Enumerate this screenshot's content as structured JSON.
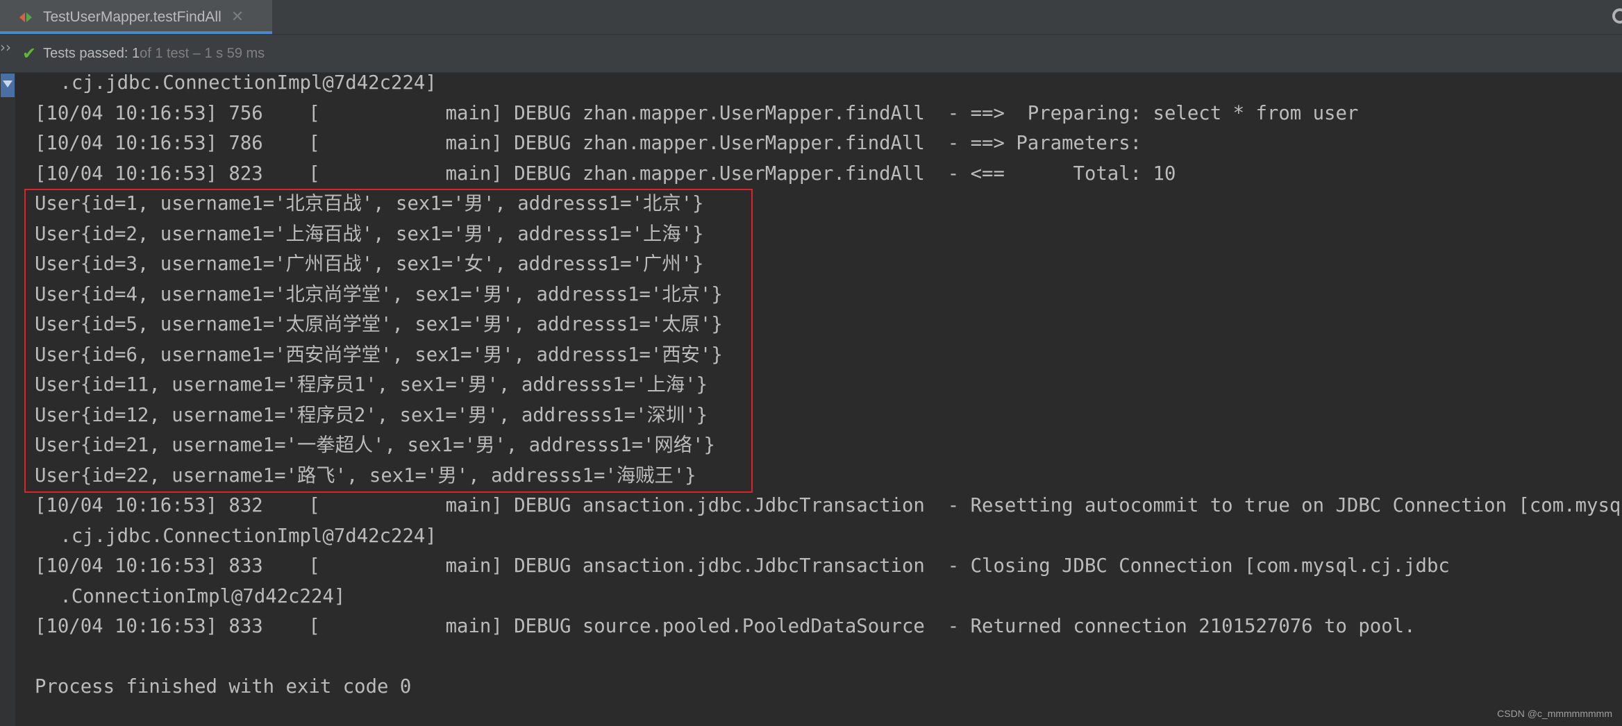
{
  "tab": {
    "label": "TestUserMapper.testFindAll",
    "close": "✕"
  },
  "status": {
    "main": "Tests passed: 1",
    "detail": " of 1 test – 1 s 59 ms"
  },
  "console": {
    "lines": [
      " .cj.jdbc.ConnectionImpl@7d42c224]",
      "[10/04 10:16:53] 756    [           main] DEBUG zhan.mapper.UserMapper.findAll  - ==>  Preparing: select * from user",
      "[10/04 10:16:53] 786    [           main] DEBUG zhan.mapper.UserMapper.findAll  - ==> Parameters: ",
      "[10/04 10:16:53] 823    [           main] DEBUG zhan.mapper.UserMapper.findAll  - <==      Total: 10",
      "User{id=1, username1='北京百战', sex1='男', addresss1='北京'}",
      "User{id=2, username1='上海百战', sex1='男', addresss1='上海'}",
      "User{id=3, username1='广州百战', sex1='女', addresss1='广州'}",
      "User{id=4, username1='北京尚学堂', sex1='男', addresss1='北京'}",
      "User{id=5, username1='太原尚学堂', sex1='男', addresss1='太原'}",
      "User{id=6, username1='西安尚学堂', sex1='男', addresss1='西安'}",
      "User{id=11, username1='程序员1', sex1='男', addresss1='上海'}",
      "User{id=12, username1='程序员2', sex1='男', addresss1='深圳'}",
      "User{id=21, username1='一拳超人', sex1='男', addresss1='网络'}",
      "User{id=22, username1='路飞', sex1='男', addresss1='海贼王'}",
      "[10/04 10:16:53] 832    [           main] DEBUG ansaction.jdbc.JdbcTransaction  - Resetting autocommit to true on JDBC Connection [com.mysql",
      " .cj.jdbc.ConnectionImpl@7d42c224]",
      "[10/04 10:16:53] 833    [           main] DEBUG ansaction.jdbc.JdbcTransaction  - Closing JDBC Connection [com.mysql.cj.jdbc",
      " .ConnectionImpl@7d42c224]",
      "[10/04 10:16:53] 833    [           main] DEBUG source.pooled.PooledDataSource  - Returned connection 2101527076 to pool.",
      "",
      "Process finished with exit code 0"
    ]
  },
  "watermark": "CSDN @c_mmmmmmmm"
}
